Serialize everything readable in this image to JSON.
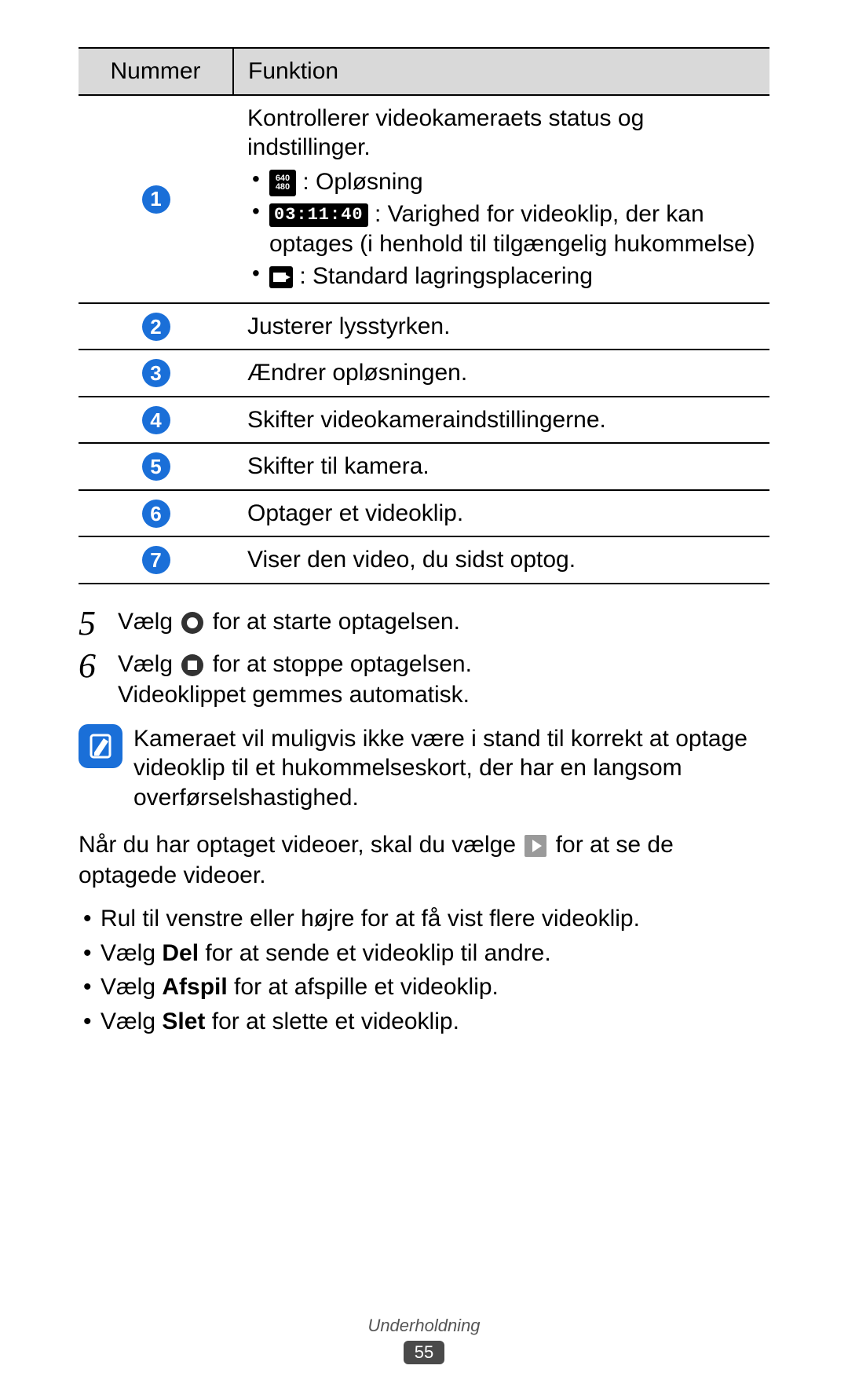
{
  "table": {
    "header_num": "Nummer",
    "header_func": "Funktion",
    "rows": {
      "1": {
        "intro": "Kontrollerer videokameraets status og indstillinger.",
        "res_top": "640",
        "res_bot": "480",
        "res_label": " : Opløsning",
        "time_value": "03:11:40",
        "duration_label": " : Varighed for videoklip, der kan optages (i henhold til tilgængelig hukommelse)",
        "storage_label": " : Standard lagringsplacering"
      },
      "2": "Justerer lysstyrken.",
      "3": "Ændrer opløsningen.",
      "4": "Skifter videokameraindstillingerne.",
      "5": "Skifter til kamera.",
      "6": "Optager et videoklip.",
      "7": "Viser den video, du sidst optog."
    }
  },
  "steps": {
    "5": {
      "n": "5",
      "before": "Vælg ",
      "after": " for at starte optagelsen."
    },
    "6": {
      "n": "6",
      "before": "Vælg ",
      "mid": " for at stoppe optagelsen.",
      "line2": "Videoklippet gemmes automatisk."
    }
  },
  "note": "Kameraet vil muligvis ikke være i stand til korrekt at optage videoklip til et hukommelseskort, der har en langsom overførselshastighed.",
  "after_note": {
    "before": "Når du har optaget videoer, skal du vælge ",
    "after": " for at se de optagede videoer."
  },
  "actions": {
    "a1": "Rul til venstre eller højre for at få vist flere videoklip.",
    "a2_pre": "Vælg ",
    "a2_bold": "Del",
    "a2_post": " for at sende et videoklip til andre.",
    "a3_pre": "Vælg ",
    "a3_bold": "Afspil",
    "a3_post": " for at afspille et videoklip.",
    "a4_pre": "Vælg ",
    "a4_bold": "Slet",
    "a4_post": " for at slette et videoklip."
  },
  "footer": {
    "section": "Underholdning",
    "page": "55"
  }
}
